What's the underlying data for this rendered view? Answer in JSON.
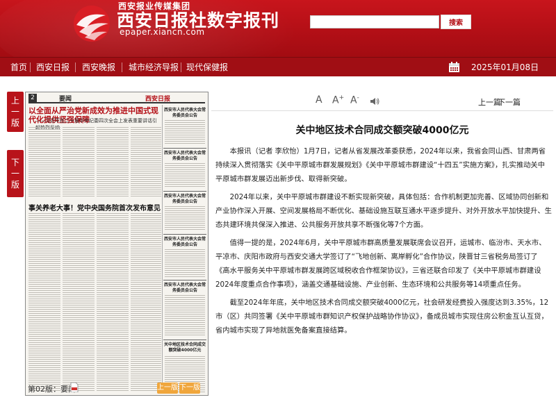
{
  "header": {
    "group_name": "西安报业传媒集团",
    "site_title": "西安日报社数字报刊",
    "site_url": "epaper.xiancn.com",
    "search_placeholder": "",
    "search_button": "搜索",
    "brand_color": "#b30f16"
  },
  "nav": {
    "items": [
      {
        "label": "首页"
      },
      {
        "label": "西安日报"
      },
      {
        "label": "西安晚报"
      },
      {
        "label": "城市经济导报"
      },
      {
        "label": "现代保健报"
      }
    ],
    "date": "2025年01月08日",
    "calendar_icon": "calendar-icon"
  },
  "side": {
    "prev_label_1": "上",
    "prev_label_2": "一",
    "prev_label_3": "版",
    "next_label_1": "下",
    "next_label_2": "一",
    "next_label_3": "版"
  },
  "paper": {
    "page_no": "2",
    "section": "要闻",
    "brand": "西安日报",
    "headline_1": "以全面从严治党新成效为推进中国式现代化提供坚强保障",
    "sub_1": "——习近平在二十届中央纪委四次全会上发表重要讲话引起热烈反响",
    "headline_2": "事关养老大事！党中央国务院首次发布意见",
    "right_titles": [
      "西安市人民代表大会常务委员会公告",
      "西安市人民代表大会常务委员会公告",
      "西安市人民代表大会常务委员会公告",
      "西安市人民代表大会常务委员会公告",
      "西安市人民代表大会常务委员会公告"
    ],
    "bottom_right_title": "关中地区技术合同成交额突破4000亿元"
  },
  "page_bar": {
    "label": "第02版：要闻",
    "prev": "上一版",
    "next": "下一版",
    "accent": "#f0a63c"
  },
  "article": {
    "toolbar": {
      "font_small": "A",
      "font_large": "A",
      "font_large_sup": "+",
      "font_reduce": "A",
      "font_reduce_sup": "-",
      "prev": "上一篇",
      "next": "下一篇"
    },
    "title": "关中地区技术合同成交额突破4000亿元",
    "paragraphs": [
      "本报讯（记者 李欣怡）1月7日，记者从省发展改革委获悉，2024年以来，我省会同山西、甘肃两省持续深入贯彻落实《关中平原城市群发展规划》《关中平原城市群建设“十四五”实施方案》，扎实推动关中平原城市群发展迈出新步伐、取得新突破。",
      "2024年以来，关中平原城市群建设不断实现新突破，具体包括：合作机制更加完善、区域协同创新和产业协作深入开展、空间发展格局不断优化、基础设施互联互通水平逐步提升、对外开放水平加快提升、生态共建环境共保深入推进、公共服务开放共享不断强化等7个方面。",
      "值得一提的是，2024年6月，关中平原城市群高质量发展联席会议召开，运城市、临汾市、天水市、平凉市、庆阳市政府与西安交通大学签订了“飞地创新、离岸孵化”合作协议，陕晋甘三省税务局签订了《高水平服务关中平原城市群发展跨区域税收合作框架协议》，三省还联合印发了《关中平原城市群建设2024年度重点合作事项》，涵盖交通基础设施、产业创新、生态环境和公共服务等14项重点任务。",
      "截至2024年年底，关中地区技术合同成交额突破4000亿元，社会研发经费投入强度达到3.35%，12市（区）共同签署《关中平原城市群知识产权保护战略协作协议》，备成员城市实现住房公积金互认互贷，省内城市实现了异地就医免备案直接结算。"
    ]
  }
}
